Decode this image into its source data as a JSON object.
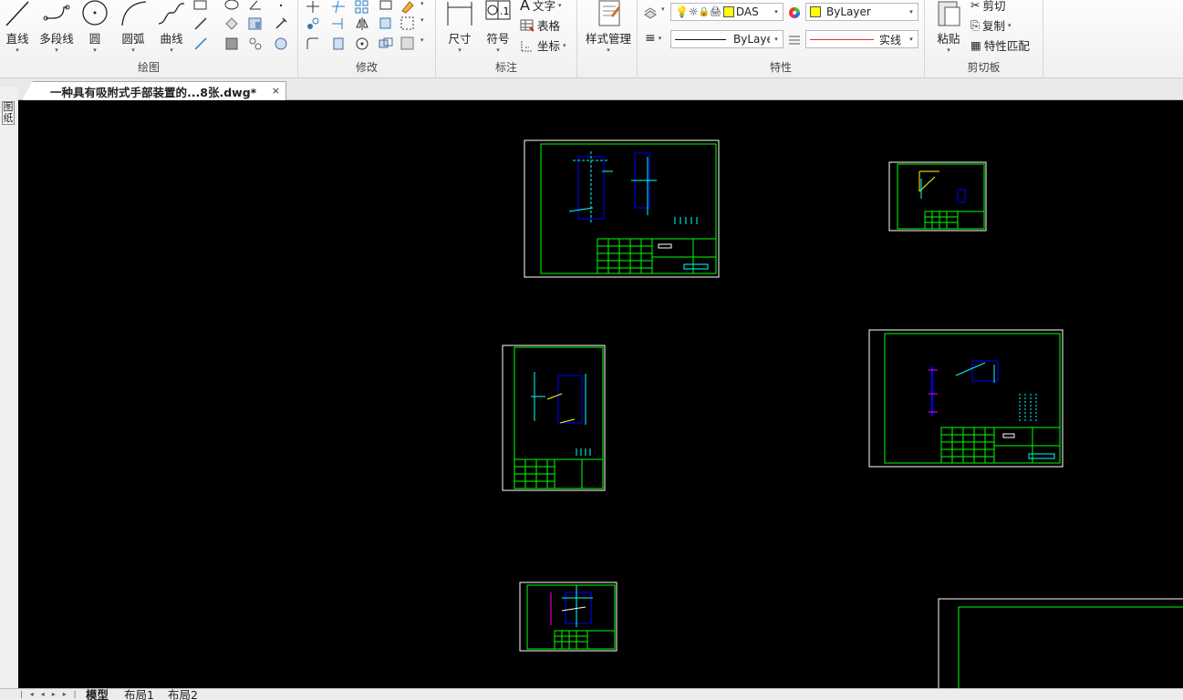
{
  "ribbon": {
    "draw": {
      "title": "绘图",
      "line": "直线",
      "polyline": "多段线",
      "circle": "圆",
      "arc": "圆弧",
      "curve": "曲线"
    },
    "modify": {
      "title": "修改"
    },
    "annotate": {
      "title": "标注",
      "dimension": "尺寸",
      "symbol": "符号",
      "text": "文字",
      "table": "表格",
      "coordinate": "坐标"
    },
    "style": {
      "label": "样式管理"
    },
    "properties": {
      "title": "特性",
      "layer_value": "DAS",
      "color_value": "ByLayer",
      "linetype_value": "ByLayer",
      "lineweight_value": "实线",
      "color_swatch": "#ffff00",
      "lineweight_color": "#e03030"
    },
    "clipboard": {
      "title": "剪切板",
      "paste": "粘贴",
      "cut": "剪切",
      "copy": "复制",
      "match": "特性匹配"
    }
  },
  "document": {
    "tab_title": "一种具有吸附式手部装置的...8张.dwg*",
    "close": "×"
  },
  "left_strip": {
    "label": "图纸"
  },
  "layout_tabs": [
    "模型",
    "布局1",
    "布局2"
  ],
  "colors": {
    "canvas_bg": "#000000",
    "frame_outer": "#ffffff",
    "frame_inner": "#00ff00",
    "geometry": "#0000ff",
    "center": "#00ffff",
    "accent": "#ff00ff"
  }
}
